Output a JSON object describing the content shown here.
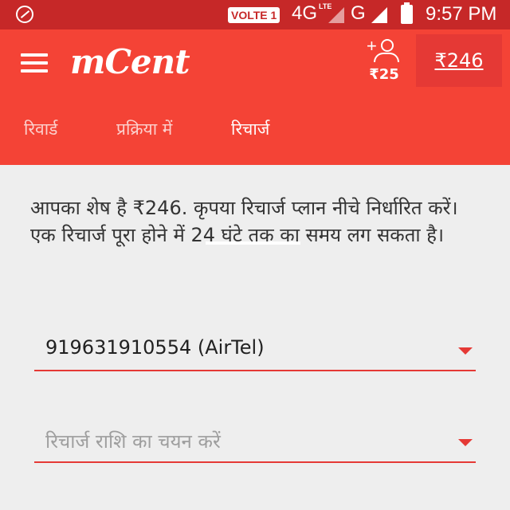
{
  "status_bar": {
    "volte": "VOLTE 1",
    "network_4g": "4G",
    "network_lte": "LTE",
    "network_g": "G",
    "time": "9:57 PM",
    "icons": [
      "app-notification-icon",
      "signal-icon",
      "battery-icon"
    ]
  },
  "app_bar": {
    "logo": "mCent",
    "invite": {
      "amount": "₹25",
      "icon": "add-person-icon"
    },
    "balance_label": "₹246",
    "colors": {
      "primary": "#f44336",
      "status": "#c62828"
    }
  },
  "tabs": [
    {
      "label": "रिवार्ड"
    },
    {
      "label": "प्रक्रिया में"
    },
    {
      "label": "रिचार्ज"
    }
  ],
  "active_tab": "रिचार्ज",
  "main": {
    "message": "आपका शेष है ₹246. कृपया रिचार्ज प्लान नीचे निर्धारित करें। एक रिचार्ज पूरा होने में 24 घंटे तक का समय लग सकता है।",
    "phone_select": {
      "value": "919631910554 (AirTel)"
    },
    "amount_select": {
      "placeholder": "रिचार्ज राशि का चयन करें"
    },
    "accent_color": "#e53935"
  }
}
